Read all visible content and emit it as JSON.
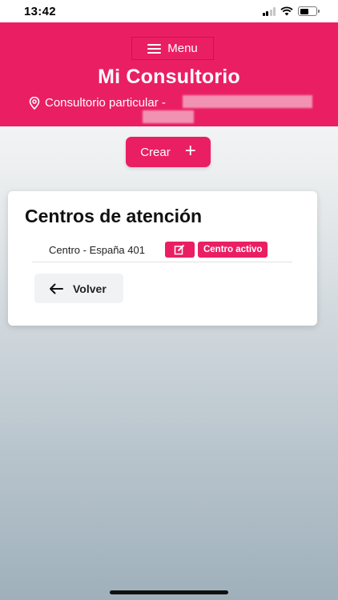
{
  "status_bar": {
    "time": "13:42"
  },
  "header": {
    "menu_label": "Menu",
    "title": "Mi Consultorio",
    "location_text": "Consultorio particular -"
  },
  "actions": {
    "create_label": "Crear"
  },
  "card": {
    "title": "Centros de atención",
    "centers": [
      {
        "name": "Centro - España 401",
        "badge": "Centro activo"
      }
    ],
    "back_label": "Volver"
  },
  "colors": {
    "accent": "#ea1f63",
    "secondary_button": "#f1f2f3"
  },
  "icons": [
    "hamburger-icon",
    "location-pin-icon",
    "plus-icon",
    "edit-icon",
    "arrow-left-icon"
  ]
}
